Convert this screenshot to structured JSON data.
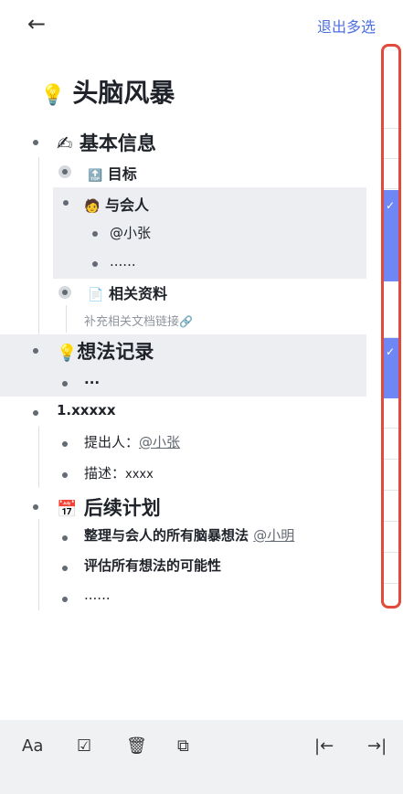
{
  "header": {
    "back_icon": "←",
    "exit_label": "退出多选"
  },
  "doc": {
    "title_icon": "💡",
    "title": "头脑风暴",
    "basic_info": {
      "icon": "✍",
      "label": "基本信息"
    },
    "goal": {
      "icon": "🔝",
      "label": "目标"
    },
    "attendees": {
      "icon": "🧑",
      "label": "与会人"
    },
    "attendee_1": "@小张",
    "attendee_more": "......",
    "materials": {
      "icon": "📄",
      "label": "相关资料"
    },
    "materials_hint": "补充相关文档链接",
    "link_icon": "🔗",
    "ideas": {
      "icon": "💡",
      "label": "想法记录"
    },
    "ideas_item": "...",
    "idea1": "1.xxxxx",
    "idea1_proposer_label": "提出人：",
    "idea1_proposer": "@小张",
    "idea1_desc_label": "描述：",
    "idea1_desc": "xxxx",
    "plan": {
      "icon": "📅",
      "label": "后续计划"
    },
    "plan_1": "整理与会人的所有脑暴想法",
    "plan_1_mention": "@小明",
    "plan_2": "评估所有想法的可能性",
    "plan_more": "......"
  },
  "toolbar": {
    "text_style": "Aa",
    "checkbox_icon": "☑",
    "delete_icon": "🗑",
    "copy_icon": "⧉",
    "outdent_icon": "|←",
    "indent_icon": "→|"
  }
}
